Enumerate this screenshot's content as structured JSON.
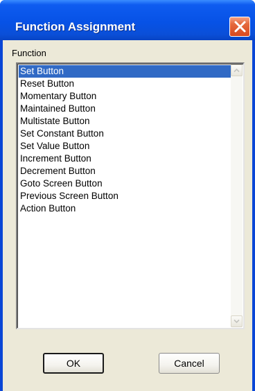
{
  "dialog": {
    "title": "Function Assignment",
    "close_icon": "close-x-icon"
  },
  "function_group": {
    "label": "Function",
    "selected_index": 0,
    "items": [
      "Set Button",
      "Reset Button",
      "Momentary Button",
      "Maintained Button",
      "Multistate Button",
      "Set Constant Button",
      "Set Value Button",
      "Increment Button",
      "Decrement Button",
      "Goto Screen Button",
      "Previous Screen Button",
      "Action Button"
    ]
  },
  "buttons": {
    "ok_label": "OK",
    "cancel_label": "Cancel"
  },
  "colors": {
    "title_bar": "#0752e6",
    "close_button": "#d8481f",
    "selection": "#316ac5",
    "client_background": "#ece9d8"
  }
}
